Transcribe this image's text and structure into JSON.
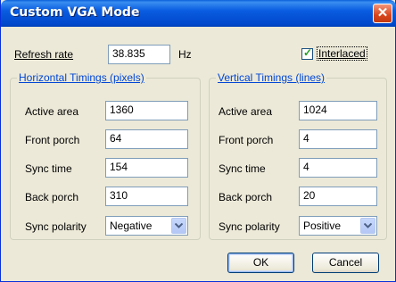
{
  "window": {
    "title": "Custom VGA Mode",
    "close_glyph": "✕"
  },
  "refresh": {
    "label": "Refresh rate",
    "value": "38.835",
    "unit": "Hz"
  },
  "interlaced": {
    "label": "Interlaced",
    "checked": true
  },
  "horizontal": {
    "title": "Horizontal Timings (pixels)",
    "active_label": "Active area",
    "active_value": "1360",
    "front_label": "Front porch",
    "front_value": "64",
    "sync_label": "Sync time",
    "sync_value": "154",
    "back_label": "Back porch",
    "back_value": "310",
    "polarity_label": "Sync polarity",
    "polarity_value": "Negative"
  },
  "vertical": {
    "title": "Vertical Timings (lines)",
    "active_label": "Active area",
    "active_value": "1024",
    "front_label": "Front porch",
    "front_value": "4",
    "sync_label": "Sync time",
    "sync_value": "4",
    "back_label": "Back porch",
    "back_value": "20",
    "polarity_label": "Sync polarity",
    "polarity_value": "Positive"
  },
  "buttons": {
    "ok": "OK",
    "cancel": "Cancel"
  },
  "colors": {
    "title_bar": "#0a5ce0",
    "group_title": "#0046d5",
    "close_button": "#d8451c",
    "dialog_bg": "#ece9d8"
  }
}
